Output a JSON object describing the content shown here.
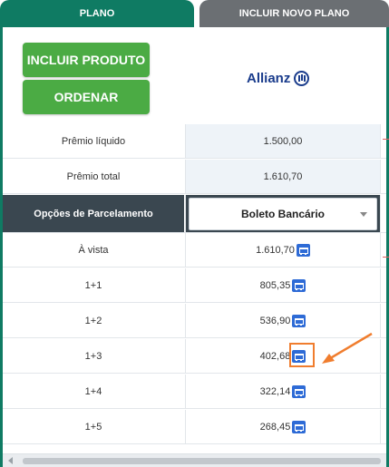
{
  "tabs": {
    "plano": "PLANO",
    "incluir_novo_plano": "INCLUIR NOVO PLANO"
  },
  "buttons": {
    "incluir_produto": "INCLUIR PRODUTO",
    "ordenar": "ORDENAR"
  },
  "brand": {
    "name": "Allianz"
  },
  "summary": [
    {
      "label": "Prêmio líquido",
      "value": "1.500,00"
    },
    {
      "label": "Prêmio total",
      "value": "1.610,70"
    }
  ],
  "parcelamento": {
    "label": "Opções de Parcelamento",
    "selected": "Boleto Bancário"
  },
  "installments": [
    {
      "label": "À vista",
      "value": "1.610,70"
    },
    {
      "label": "1+1",
      "value": "805,35"
    },
    {
      "label": "1+2",
      "value": "536,90"
    },
    {
      "label": "1+3",
      "value": "402,68"
    },
    {
      "label": "1+4",
      "value": "322,14"
    },
    {
      "label": "1+5",
      "value": "268,45"
    }
  ],
  "colors": {
    "accent": "#0f7b63",
    "button": "#4bab44",
    "header_row": "#3a4750",
    "highlight": "#f07d2e",
    "cart_icon": "#2e6bd6"
  }
}
